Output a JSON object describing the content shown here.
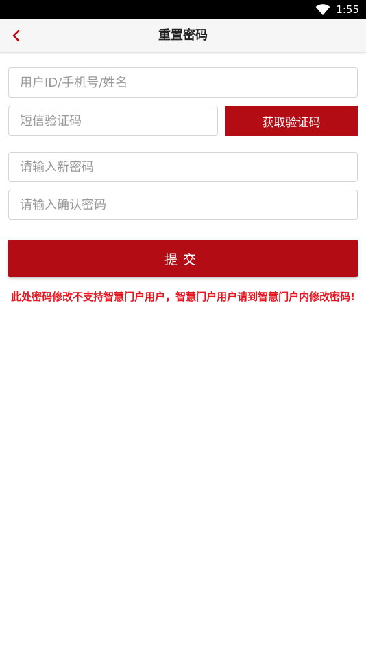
{
  "status_bar": {
    "time": "1:55",
    "wifi_icon": "wifi-icon"
  },
  "header": {
    "back_icon": "chevron-left-icon",
    "title": "重置密码",
    "accent_color": "#b30c15"
  },
  "form": {
    "user_placeholder": "用户ID/手机号/姓名",
    "sms_placeholder": "短信验证码",
    "get_code_label": "获取验证码",
    "new_password_placeholder": "请输入新密码",
    "confirm_password_placeholder": "请输入确认密码",
    "submit_label": "提交"
  },
  "notice": "此处密码修改不支持智慧门户用户，智慧门户用户请到智慧门户内修改密码!",
  "colors": {
    "primary": "#b30c15",
    "notice": "#e8141e"
  }
}
